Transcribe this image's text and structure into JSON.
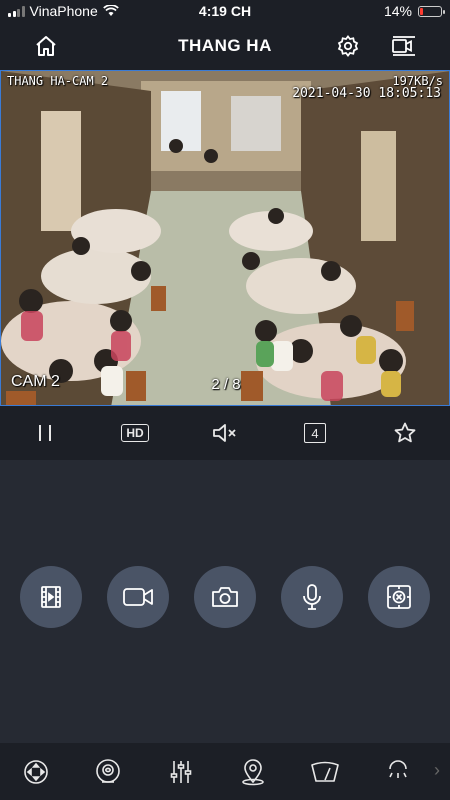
{
  "status_bar": {
    "carrier": "VinaPhone",
    "time": "4:19 CH",
    "battery": "14%",
    "battery_level": 0.14
  },
  "header": {
    "title": "THANG HA"
  },
  "video": {
    "camera_name": "THANG HA-CAM 2",
    "bitrate": "197KB/s",
    "timestamp": "2021-04-30 18:05:13",
    "channel_label": "CAM 2",
    "page": "2 / 8"
  },
  "toolbar": {
    "hd_label": "HD",
    "layout_label": "4"
  },
  "icons": {
    "home": "home-icon",
    "settings": "gear-icon",
    "device": "device-icon",
    "pause": "pause-icon",
    "mute": "speaker-mute-icon",
    "favorite": "star-icon",
    "playback": "film-icon",
    "record": "video-camera-icon",
    "snapshot": "camera-icon",
    "talk": "microphone-icon",
    "ptz": "ptz-icon"
  },
  "colors": {
    "background": "#1c1f26",
    "panel": "#262a33",
    "control_button": "#4a5466",
    "video_border": "#3a7bd5"
  }
}
